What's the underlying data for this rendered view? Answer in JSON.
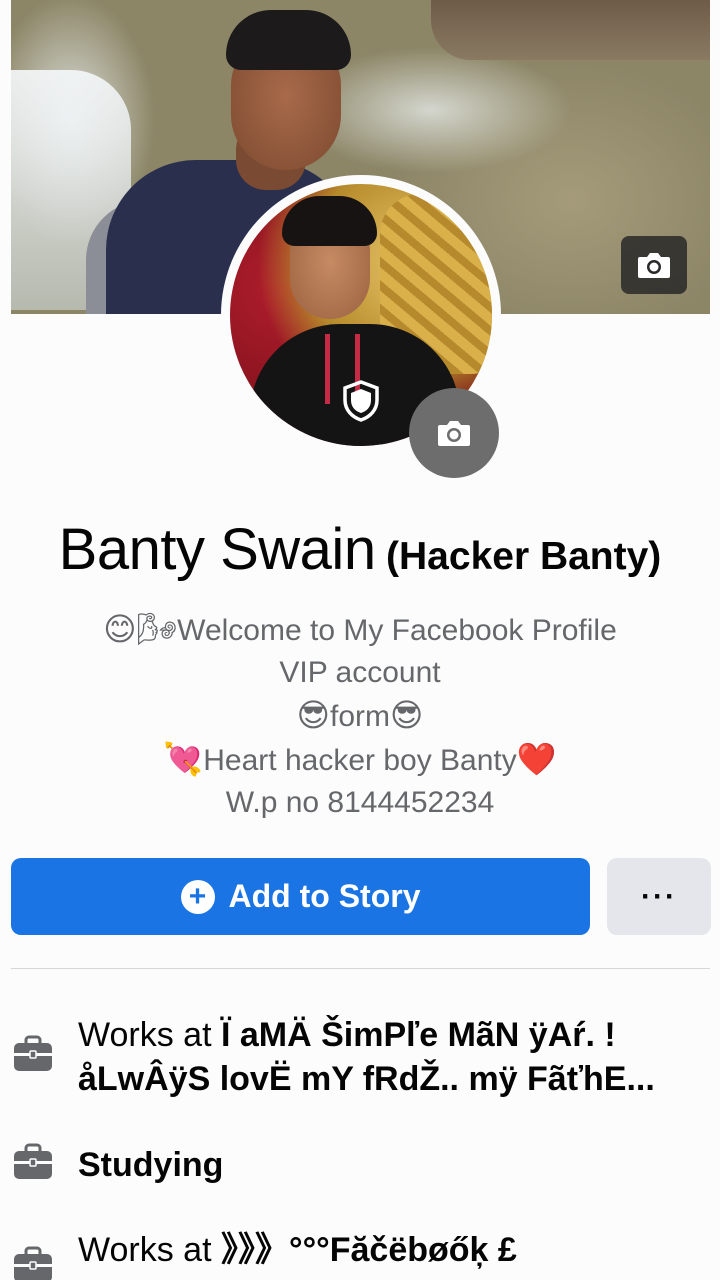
{
  "cover": {
    "camera_icon": "camera-icon"
  },
  "avatar": {
    "shield_icon": "shield-icon",
    "camera_icon": "camera-icon"
  },
  "profile": {
    "name": "Banty Swain",
    "nickname": "(Hacker Banty)"
  },
  "bio": {
    "line1_emoji_a": "😊",
    "line1_emoji_b": "🌬",
    "line1_text": "Welcome to My Facebook Profile",
    "line2": "VIP account",
    "line3_emoji": "😎",
    "line3_text": "form",
    "line4_emoji_a": "💘",
    "line4_text": "Heart hacker boy Banty",
    "line4_emoji_b": "❤️",
    "line5": "W.p no 8144452234"
  },
  "actions": {
    "add_story_label": "Add to Story",
    "add_story_icon": "plus-circle-icon",
    "more_label": "···"
  },
  "info": [
    {
      "icon": "briefcase-icon",
      "prefix": "Works at ",
      "value_line1": "Ï aMÄ ŠimPľe MãN ÿAŕ. !",
      "value_line2": "åLwÂÿS lovË mY fRdŽ.. mÿ FãťhE..."
    },
    {
      "icon": "briefcase-icon",
      "prefix": "",
      "value_line1": "Studying"
    },
    {
      "icon": "briefcase-icon",
      "prefix": "Works at ",
      "value_line1": "》》》°°°Făčëbøőķ £"
    }
  ],
  "colors": {
    "primary": "#1b74e4",
    "secondary_button": "#e4e6eb",
    "bio_text": "#65676b"
  }
}
